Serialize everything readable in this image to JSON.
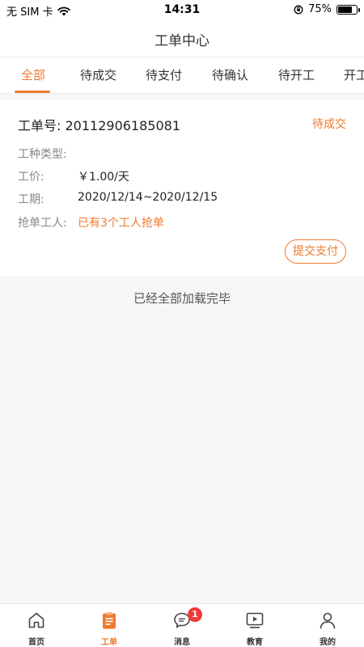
{
  "status_bar": {
    "carrier": "无 SIM 卡",
    "time": "14:31",
    "battery_percent": "75%",
    "battery_level": 0.75
  },
  "nav": {
    "title": "工单中心"
  },
  "tabs": [
    {
      "label": "全部",
      "active": true
    },
    {
      "label": "待成交",
      "active": false
    },
    {
      "label": "待支付",
      "active": false
    },
    {
      "label": "待确认",
      "active": false
    },
    {
      "label": "待开工",
      "active": false
    },
    {
      "label": "开工",
      "active": false
    }
  ],
  "order": {
    "number_label": "工单号:",
    "number": "20112906185081",
    "status": "待成交",
    "work_type_label": "工种类型:",
    "work_type_value": "",
    "price_label": "工价:",
    "price_value": "￥1.00/天",
    "period_label": "工期:",
    "period_value": "2020/12/14~2020/12/15",
    "grab_label": "抢单工人:",
    "grab_value": "已有3个工人抢单",
    "pay_button": "提交支付"
  },
  "list_footer": "已经全部加载完毕",
  "tabbar": {
    "items": [
      {
        "label": "首页",
        "icon": "home-icon",
        "active": false
      },
      {
        "label": "工单",
        "icon": "clipboard-icon",
        "active": true
      },
      {
        "label": "消息",
        "icon": "message-icon",
        "active": false,
        "badge": "1"
      },
      {
        "label": "教育",
        "icon": "video-icon",
        "active": false
      },
      {
        "label": "我的",
        "icon": "user-icon",
        "active": false
      }
    ]
  },
  "colors": {
    "accent": "#ee7a2f",
    "badge": "#f03a3a"
  }
}
